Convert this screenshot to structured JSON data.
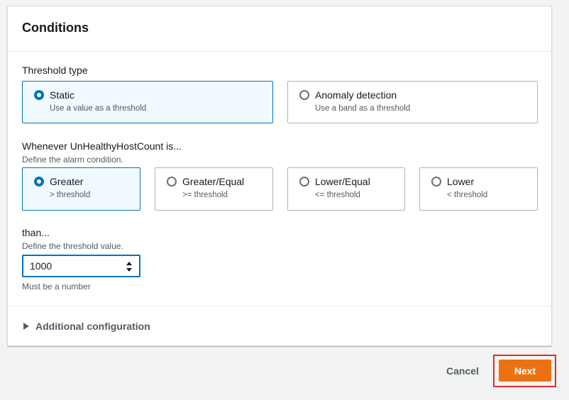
{
  "panel": {
    "title": "Conditions"
  },
  "threshold_type": {
    "label": "Threshold type",
    "options": [
      {
        "label": "Static",
        "desc": "Use a value as a threshold",
        "selected": true
      },
      {
        "label": "Anomaly detection",
        "desc": "Use a band as a threshold",
        "selected": false
      }
    ]
  },
  "condition": {
    "label": "Whenever UnHealthyHostCount is...",
    "desc": "Define the alarm condition.",
    "options": [
      {
        "label": "Greater",
        "desc": "> threshold",
        "selected": true
      },
      {
        "label": "Greater/Equal",
        "desc": ">= threshold",
        "selected": false
      },
      {
        "label": "Lower/Equal",
        "desc": "<= threshold",
        "selected": false
      },
      {
        "label": "Lower",
        "desc": "< threshold",
        "selected": false
      }
    ]
  },
  "threshold_value": {
    "label": "than...",
    "desc": "Define the threshold value.",
    "value": "1000",
    "hint": "Must be a number"
  },
  "additional": {
    "label": "Additional configuration"
  },
  "footer": {
    "cancel_label": "Cancel",
    "next_label": "Next"
  },
  "colors": {
    "accent": "#0073bb",
    "primary_button": "#ec7211",
    "highlight": "#e02d2d"
  }
}
